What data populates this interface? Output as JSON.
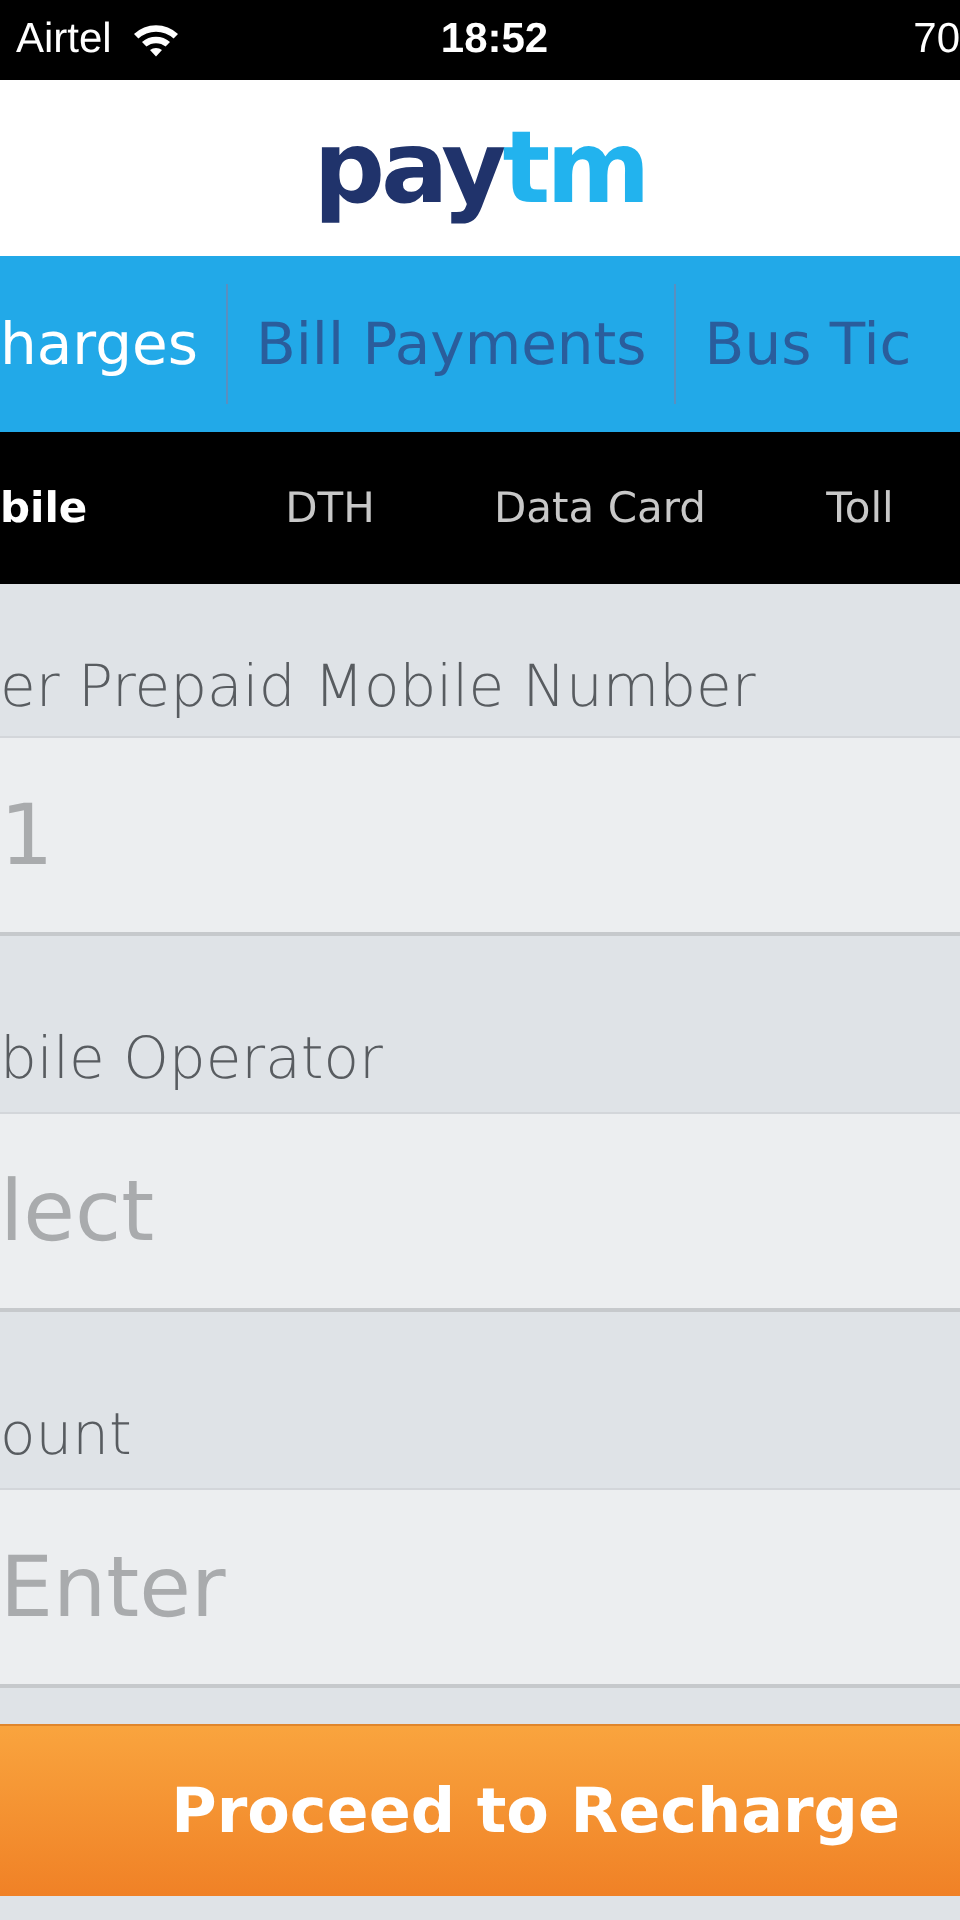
{
  "status_bar": {
    "carrier": "Airtel",
    "time": "18:52",
    "battery": "70"
  },
  "logo": {
    "dark_part": "pay",
    "light_part": "tm"
  },
  "tabs": [
    {
      "label": "harges",
      "selected": true
    },
    {
      "label": "Bill Payments",
      "selected": false
    },
    {
      "label": "Bus Tic",
      "selected": false
    }
  ],
  "sub_tabs": [
    {
      "label": "bile",
      "selected": true
    },
    {
      "label": "DTH",
      "selected": false
    },
    {
      "label": "Data Card",
      "selected": false
    },
    {
      "label": "Toll",
      "selected": false
    }
  ],
  "fields": [
    {
      "label": "er Prepaid Mobile Number",
      "placeholder": "1"
    },
    {
      "label": "bile Operator",
      "placeholder": "lect"
    },
    {
      "label": "ount",
      "placeholder": "Enter"
    }
  ],
  "button": "Proceed to Recharge"
}
